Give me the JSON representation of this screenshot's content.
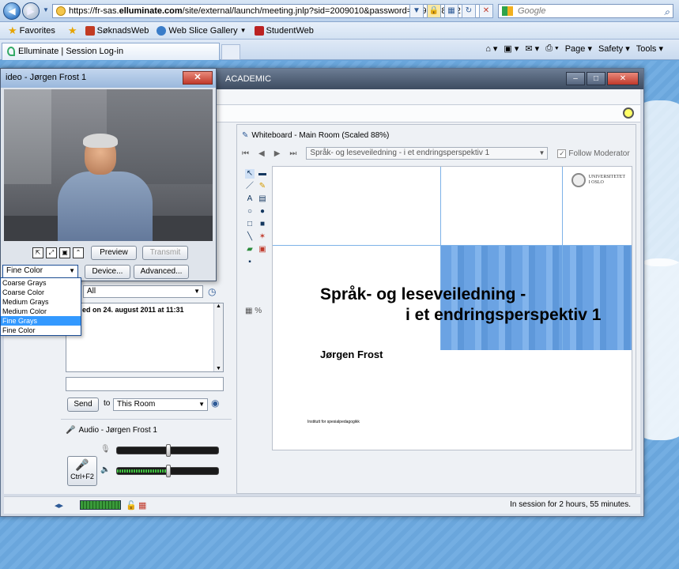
{
  "browser": {
    "url_prefix": "https://fr-sas.",
    "url_host": "elluminate.com",
    "url_rest": "/site/external/launch/meeting.jnlp?sid=2009010&password=M.912F8982",
    "search_placeholder": "Google",
    "favorites": {
      "favorites_label": "Favorites",
      "item1": "SøknadsWeb",
      "item2": "Web Slice Gallery",
      "item3": "StudentWeb"
    },
    "tab_title": "Elluminate | Session Log-in",
    "commands": {
      "page": "Page",
      "safety": "Safety",
      "tools": "Tools"
    }
  },
  "elluminate": {
    "title_fragment": "ACADEMIC",
    "chat": {
      "filter_value": "All",
      "message_fragment": "ed on 24. august 2011 at 11:31",
      "send_label": "Send",
      "to_label": "to",
      "room_value": "This Room"
    },
    "audio": {
      "title": "Audio - Jørgen Frost 1",
      "talk_label": "Ctrl+F2",
      "mic_level": 0.5,
      "speaker_level": 0.5
    },
    "whiteboard": {
      "title": "Whiteboard - Main Room (Scaled 88%)",
      "page_select": "Språk- og leseveiledning - i et endringsperspektiv 1",
      "follow_label": "Follow Moderator",
      "slide": {
        "title_line1": "Språk- og leseveiledning  -",
        "title_line2": "i et endringsperspektiv 1",
        "author": "Jørgen Frost",
        "institute": "Institutt for spesialpedagogikk",
        "logo_line1": "UNIVERSITETET",
        "logo_line2": "I OSLO"
      }
    },
    "status": "In session for 2 hours, 55 minutes."
  },
  "video": {
    "title": "ideo - Jørgen Frost 1",
    "preview_label": "Preview",
    "transmit_label": "Transmit",
    "quality_value": "Fine Color",
    "device_label": "Device...",
    "advanced_label": "Advanced...",
    "quality_options": [
      "Coarse Grays",
      "Coarse Color",
      "Medium Grays",
      "Medium Color",
      "Fine Grays",
      "Fine Color"
    ],
    "highlighted_option": "Fine Grays"
  }
}
